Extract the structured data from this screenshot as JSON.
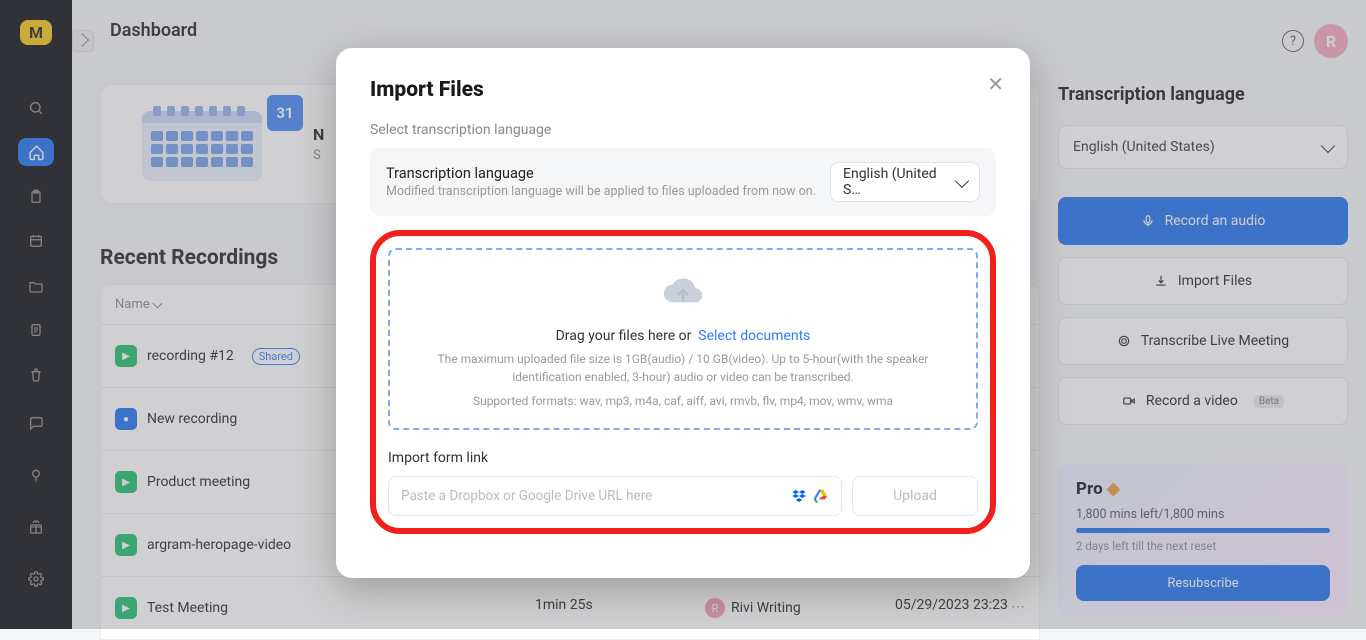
{
  "app": {
    "logo_letter": "M"
  },
  "header": {
    "title": "Dashboard",
    "avatar_letter": "R"
  },
  "calendar_card": {
    "title": "N",
    "subtitle": "S",
    "badge31": "31"
  },
  "section_title": "Recent Recordings",
  "columns": {
    "name": "Name",
    "duration": "",
    "editor": "",
    "date": ""
  },
  "recordings": [
    {
      "name": "recording #12",
      "shared": "Shared",
      "duration": "",
      "editor": "",
      "date": ""
    },
    {
      "name": "New recording",
      "duration": "",
      "editor": "",
      "date": ""
    },
    {
      "name": "Product meeting",
      "duration": "",
      "editor": "",
      "date": ""
    },
    {
      "name": "argram-heropage-video",
      "duration": "",
      "editor": "",
      "date": ""
    },
    {
      "name": "Test Meeting",
      "duration": "1min 25s",
      "editor": "Rivi Writing",
      "date": "05/29/2023 23:23"
    }
  ],
  "right": {
    "title": "Transcription language",
    "language": "English (United States)",
    "record_audio": "Record an audio",
    "import_files": "Import Files",
    "transcribe_live": "Transcribe Live Meeting",
    "record_video": "Record a video",
    "beta": "Beta"
  },
  "pro": {
    "title": "Pro",
    "mins": "1,800 mins left/1,800 mins",
    "days": "2 days left till the next reset",
    "resubscribe": "Resubscribe"
  },
  "modal": {
    "title": "Import Files",
    "select_lang": "Select transcription language",
    "lang_label": "Transcription language",
    "lang_desc": "Modified transcription language will be applied to files uploaded from now on.",
    "lang_value_short": "English (United S…",
    "drop_main": "Drag your files here or",
    "drop_link": "Select documents",
    "drop_desc1": "The maximum uploaded file size is 1GB(audio) / 10 GB(video). Up to 5-hour(with the speaker identification enabled, 3-hour) audio or video can be transcribed.",
    "drop_desc2": "Supported formats: wav, mp3, m4a, caf, aiff, avi, rmvb, flv, mp4, mov, wmv, wma",
    "import_link_label": "Import form link",
    "url_placeholder": "Paste a Dropbox or Google Drive URL here",
    "upload": "Upload"
  }
}
